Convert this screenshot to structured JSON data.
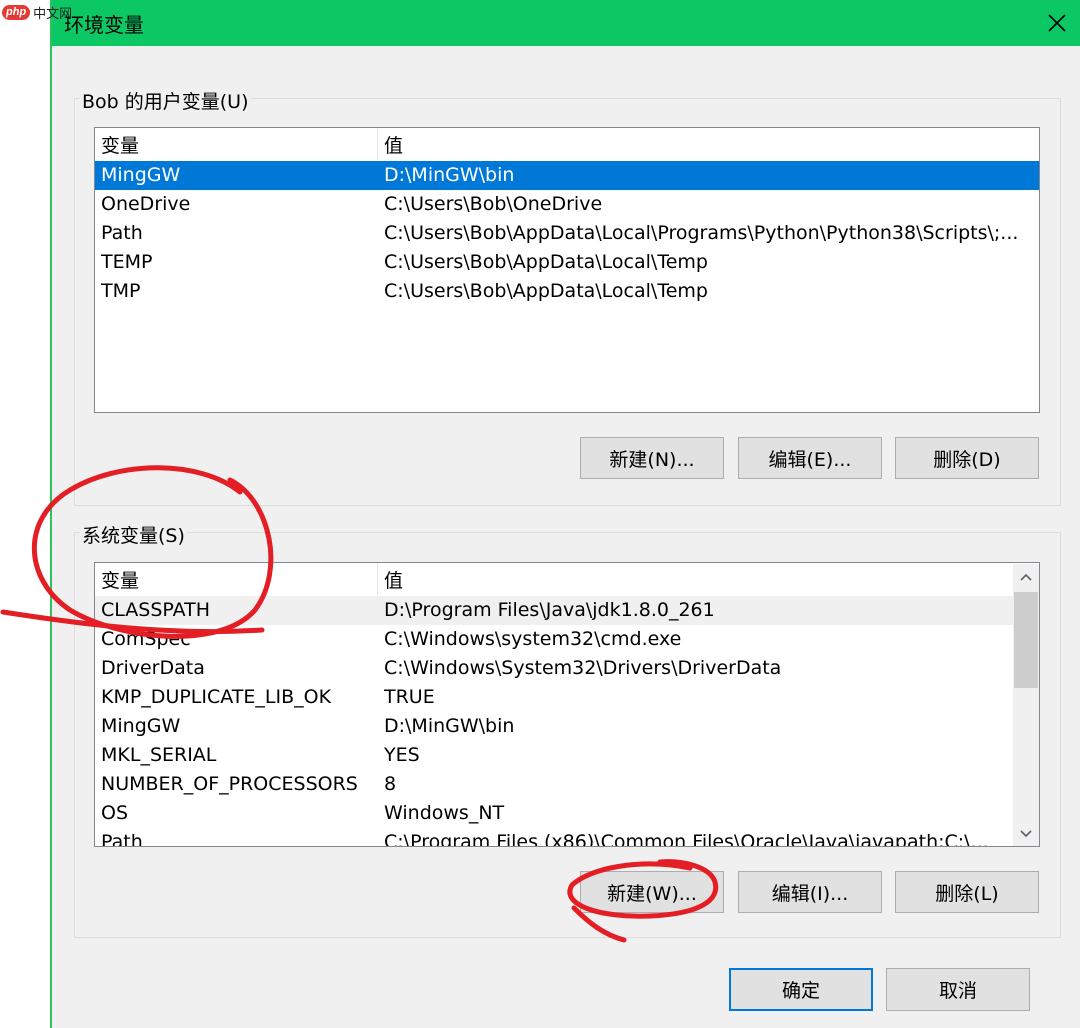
{
  "watermark": {
    "logo": "php",
    "text": "中文网"
  },
  "window": {
    "title": "环境变量",
    "close_icon": "close-icon"
  },
  "user_vars": {
    "label": "Bob 的用户变量(U)",
    "columns": [
      "变量",
      "值"
    ],
    "rows": [
      {
        "name": "MingGW",
        "value": "D:\\MinGW\\bin",
        "selected": true
      },
      {
        "name": "OneDrive",
        "value": "C:\\Users\\Bob\\OneDrive"
      },
      {
        "name": "Path",
        "value": "C:\\Users\\Bob\\AppData\\Local\\Programs\\Python\\Python38\\Scripts\\;..."
      },
      {
        "name": "TEMP",
        "value": "C:\\Users\\Bob\\AppData\\Local\\Temp"
      },
      {
        "name": "TMP",
        "value": "C:\\Users\\Bob\\AppData\\Local\\Temp"
      }
    ],
    "buttons": {
      "new": "新建(N)...",
      "edit": "编辑(E)...",
      "delete": "删除(D)"
    }
  },
  "system_vars": {
    "label": "系统变量(S)",
    "columns": [
      "变量",
      "值"
    ],
    "rows": [
      {
        "name": "CLASSPATH",
        "value": "D:\\Program Files\\Java\\jdk1.8.0_261",
        "hover": true
      },
      {
        "name": "ComSpec",
        "value": "C:\\Windows\\system32\\cmd.exe"
      },
      {
        "name": "DriverData",
        "value": "C:\\Windows\\System32\\Drivers\\DriverData"
      },
      {
        "name": "KMP_DUPLICATE_LIB_OK",
        "value": "TRUE"
      },
      {
        "name": "MingGW",
        "value": "D:\\MinGW\\bin"
      },
      {
        "name": "MKL_SERIAL",
        "value": "YES"
      },
      {
        "name": "NUMBER_OF_PROCESSORS",
        "value": "8"
      },
      {
        "name": "OS",
        "value": "Windows_NT"
      },
      {
        "name": "Path",
        "value": "C:\\Program Files (x86)\\Common Files\\Oracle\\Java\\javapath;C:\\..."
      }
    ],
    "buttons": {
      "new": "新建(W)...",
      "edit": "编辑(I)...",
      "delete": "删除(L)"
    },
    "scrollbar": {
      "up_icon": "chevron-up-icon",
      "down_icon": "chevron-down-icon"
    }
  },
  "footer": {
    "ok": "确定",
    "cancel": "取消"
  },
  "colors": {
    "title_bar": "#0bc864",
    "selection": "#0078d7",
    "annotation": "#e31e24"
  }
}
